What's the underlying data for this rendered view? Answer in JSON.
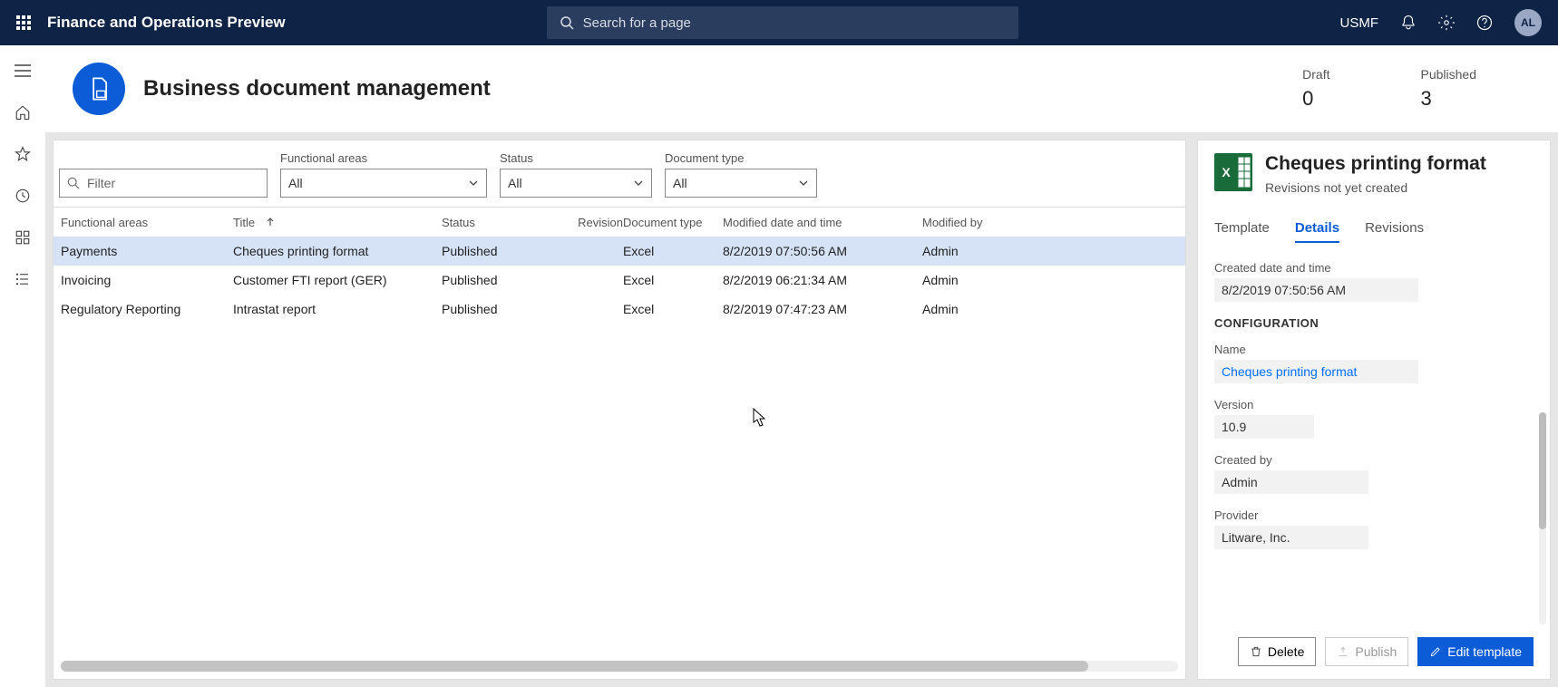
{
  "topbar": {
    "app_title": "Finance and Operations Preview",
    "search_placeholder": "Search for a page",
    "legal_entity": "USMF",
    "avatar_initials": "AL"
  },
  "page": {
    "title": "Business document management",
    "counters": {
      "draft_label": "Draft",
      "draft_value": "0",
      "published_label": "Published",
      "published_value": "3"
    }
  },
  "filters": {
    "filter_placeholder": "Filter",
    "functional_areas_label": "Functional areas",
    "functional_areas_value": "All",
    "status_label": "Status",
    "status_value": "All",
    "doctype_label": "Document type",
    "doctype_value": "All"
  },
  "table": {
    "headers": {
      "functional_areas": "Functional areas",
      "title": "Title",
      "status": "Status",
      "revision": "Revision",
      "doctype": "Document type",
      "modified_datetime": "Modified date and time",
      "modified_by": "Modified by"
    },
    "rows": [
      {
        "fa": "Payments",
        "title": "Cheques printing format",
        "status": "Published",
        "revision": "",
        "doctype": "Excel",
        "mdt": "8/2/2019 07:50:56 AM",
        "mby": "Admin"
      },
      {
        "fa": "Invoicing",
        "title": "Customer FTI report (GER)",
        "status": "Published",
        "revision": "",
        "doctype": "Excel",
        "mdt": "8/2/2019 06:21:34 AM",
        "mby": "Admin"
      },
      {
        "fa": "Regulatory Reporting",
        "title": "Intrastat report",
        "status": "Published",
        "revision": "",
        "doctype": "Excel",
        "mdt": "8/2/2019 07:47:23 AM",
        "mby": "Admin"
      }
    ]
  },
  "details": {
    "title": "Cheques printing format",
    "subtitle": "Revisions not yet created",
    "tabs": {
      "template": "Template",
      "details": "Details",
      "revisions": "Revisions"
    },
    "created_label": "Created date and time",
    "created_value": "8/2/2019 07:50:56 AM",
    "config_header": "CONFIGURATION",
    "name_label": "Name",
    "name_value": "Cheques printing format",
    "version_label": "Version",
    "version_value": "10.9",
    "createdby_label": "Created by",
    "createdby_value": "Admin",
    "provider_label": "Provider",
    "provider_value": "Litware, Inc.",
    "delete_label": "Delete",
    "publish_label": "Publish",
    "edit_label": "Edit template"
  }
}
